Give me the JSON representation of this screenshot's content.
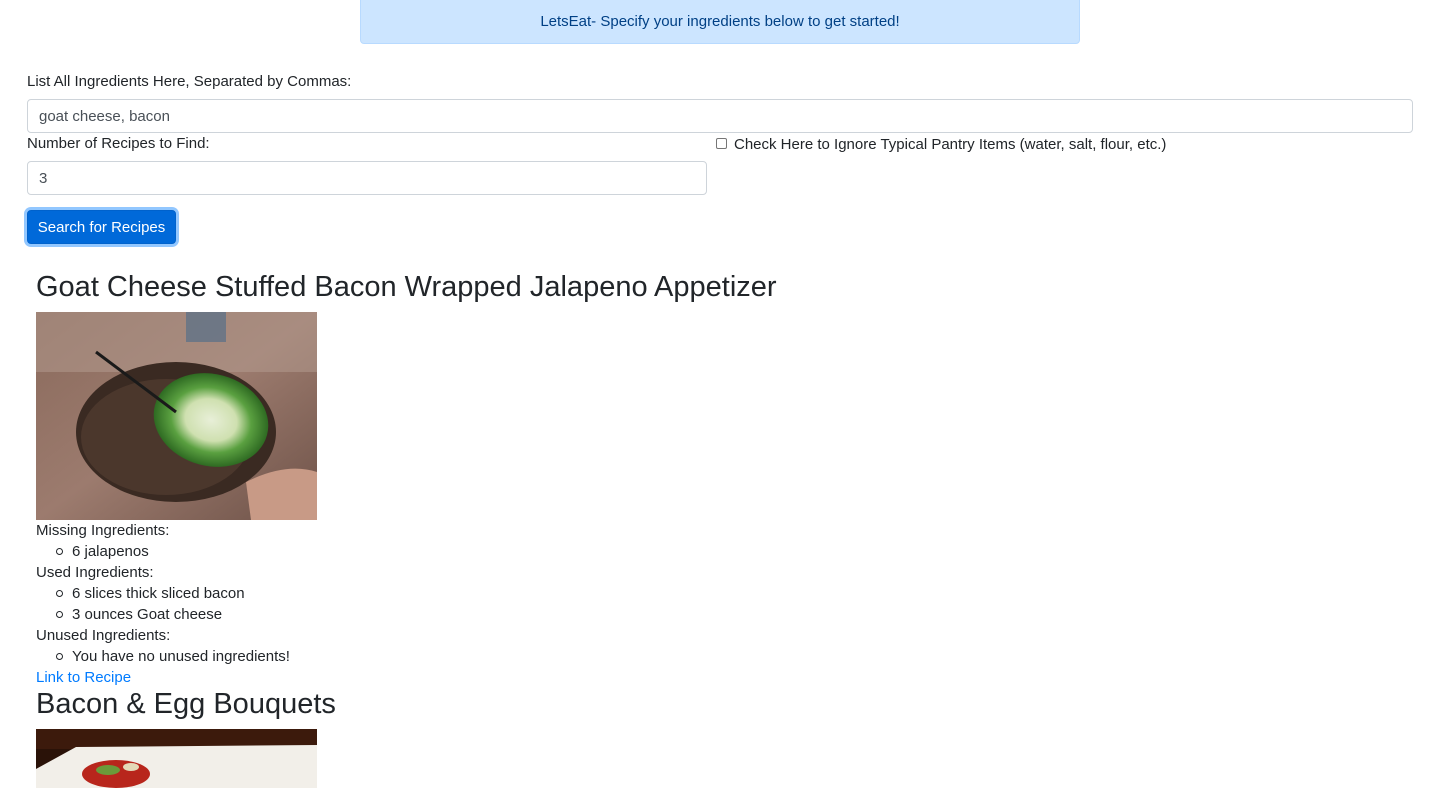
{
  "banner": {
    "text": "LetsEat- Specify your ingredients below to get started!"
  },
  "form": {
    "ingredients_label": "List All Ingredients Here, Separated by Commas:",
    "ingredients_value": "goat cheese, bacon",
    "count_label": "Number of Recipes to Find:",
    "count_value": "3",
    "pantry_label": "Check Here to Ignore Typical Pantry Items (water, salt, flour, etc.)",
    "pantry_checked": false,
    "search_button": "Search for Recipes"
  },
  "recipes": [
    {
      "title": "Goat Cheese Stuffed Bacon Wrapped Jalapeno Appetizer",
      "missing_label": "Missing Ingredients:",
      "missing": [
        "6 jalapenos"
      ],
      "used_label": "Used Ingredients:",
      "used": [
        "6 slices thick sliced bacon",
        "3 ounces Goat cheese"
      ],
      "unused_label": "Unused Ingredients:",
      "unused": [
        "You have no unused ingredients!"
      ],
      "link_text": "Link to Recipe"
    },
    {
      "title": "Bacon & Egg Bouquets"
    }
  ],
  "colors": {
    "banner_bg": "#cce5ff",
    "banner_text": "#004085",
    "button_bg": "#0069d9",
    "link": "#007bff"
  }
}
